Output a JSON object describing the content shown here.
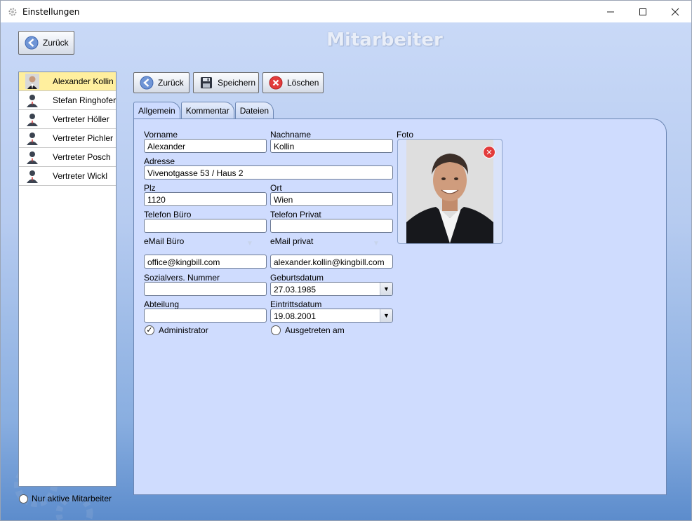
{
  "window": {
    "title": "Einstellungen"
  },
  "header": {
    "back_label": "Zurück",
    "page_title": "Mitarbeiter"
  },
  "employees": [
    {
      "name": "Alexander Kollin",
      "selected": true
    },
    {
      "name": "Stefan Ringhofer",
      "selected": false
    },
    {
      "name": "Vertreter Höller",
      "selected": false
    },
    {
      "name": "Vertreter Pichler",
      "selected": false
    },
    {
      "name": "Vertreter Posch",
      "selected": false
    },
    {
      "name": "Vertreter Wickl",
      "selected": false
    }
  ],
  "filter": {
    "only_active_label": "Nur aktive Mitarbeiter"
  },
  "toolbar": {
    "back_label": "Zurück",
    "save_label": "Speichern",
    "delete_label": "Löschen"
  },
  "tabs": [
    {
      "label": "Allgemein",
      "active": true
    },
    {
      "label": "Kommentar",
      "active": false
    },
    {
      "label": "Dateien",
      "active": false
    }
  ],
  "form": {
    "vorname": {
      "label": "Vorname",
      "value": "Alexander"
    },
    "nachname": {
      "label": "Nachname",
      "value": "Kollin"
    },
    "adresse": {
      "label": "Adresse",
      "value": "Vivenotgasse 53 / Haus 2"
    },
    "plz": {
      "label": "Plz",
      "value": "1120"
    },
    "ort": {
      "label": "Ort",
      "value": "Wien"
    },
    "telefon_buero": {
      "label": "Telefon Büro",
      "value": ""
    },
    "telefon_privat": {
      "label": "Telefon Privat",
      "value": ""
    },
    "email_buero": {
      "label": "eMail Büro",
      "value": "office@kingbill.com"
    },
    "email_privat": {
      "label": "eMail privat",
      "value": "alexander.kollin@kingbill.com"
    },
    "sozialvers": {
      "label": "Sozialvers. Nummer",
      "value": ""
    },
    "geburtsdatum": {
      "label": "Geburtsdatum",
      "value": "27.03.1985"
    },
    "abteilung": {
      "label": "Abteilung",
      "value": ""
    },
    "eintrittsdatum": {
      "label": "Eintrittsdatum",
      "value": "19.08.2001"
    },
    "administrator": {
      "label": "Administrator",
      "checked": true
    },
    "ausgetreten": {
      "label": "Ausgetreten am",
      "checked": false
    },
    "foto_label": "Foto"
  },
  "colors": {
    "accent_selected": "#ffef9e",
    "panel_bg": "#cfdcfe",
    "delete_red": "#e23b3b"
  }
}
